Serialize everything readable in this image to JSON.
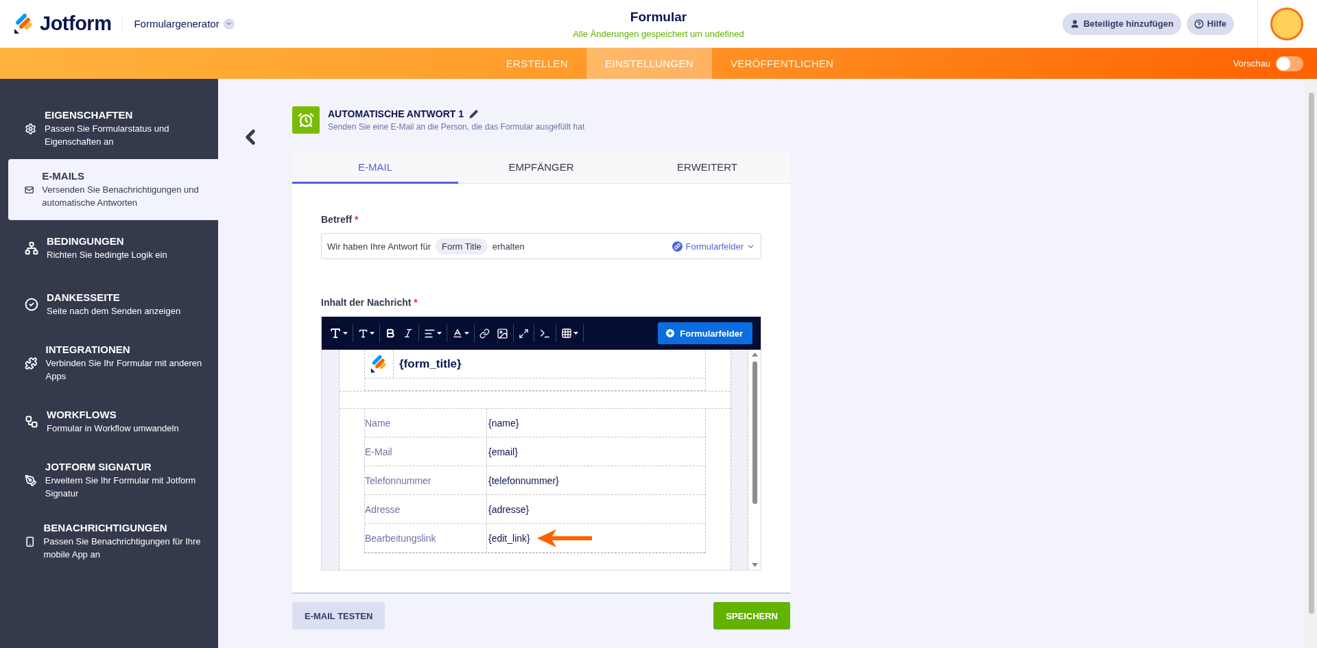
{
  "header": {
    "logo": "Jotform",
    "builder_menu": "Formulargenerator",
    "title": "Formular",
    "status": "Alle Änderungen gespeichert um undefined",
    "buttons": [
      {
        "label": "Beteiligte hinzufügen",
        "kind": "user"
      },
      {
        "label": "Hilfe",
        "kind": "help"
      }
    ]
  },
  "nav_tabs": [
    {
      "label": "ERSTELLEN",
      "selected": false
    },
    {
      "label": "EINSTELLUNGEN",
      "selected": true
    },
    {
      "label": "VERÖFFENTLICHEN",
      "selected": false
    }
  ],
  "preview": {
    "label": "Vorschau",
    "on": false
  },
  "sidebar": {
    "items": [
      {
        "kind": "gear",
        "title": "EIGENSCHAFTEN",
        "description": "Passen Sie Formularstatus und Eigenschaften an",
        "selected": false
      },
      {
        "kind": "mail",
        "title": "E-MAILS",
        "description": "Versenden Sie Benachrichtigungen und automatische Antworten",
        "selected": true
      },
      {
        "kind": "logic",
        "title": "BEDINGUNGEN",
        "description": "Richten Sie bedingte Logik ein",
        "selected": false
      },
      {
        "kind": "check",
        "title": "DANKESSEITE",
        "description": "Seite nach dem Senden anzeigen",
        "selected": false
      },
      {
        "kind": "puzzle",
        "title": "INTEGRATIONEN",
        "description": "Verbinden Sie Ihr Formular mit anderen Apps",
        "selected": false
      },
      {
        "kind": "workflow",
        "title": "WORKFLOWS",
        "description": "Formular in Workflow umwandeln",
        "selected": false
      },
      {
        "kind": "pen",
        "title": "JOTFORM SIGNATUR",
        "description": "Erweitern Sie Ihr Formular mit Jotform Signatur",
        "selected": false
      },
      {
        "kind": "phone",
        "title": "BENACHRICHTIGUNGEN",
        "description": "Passen Sie Benachrichtigungen für Ihre mobile App an",
        "selected": false
      }
    ]
  },
  "page": {
    "title": "AUTOMATISCHE ANTWORT 1",
    "subtitle": "Senden Sie eine E-Mail an die Person, die das Formular ausgefüllt hat"
  },
  "tabs": [
    {
      "label": "E-MAIL",
      "selected": true
    },
    {
      "label": "EMPFÄNGER",
      "selected": false
    },
    {
      "label": "ERWEITERT",
      "selected": false
    }
  ],
  "subject": {
    "label": "Betreff",
    "required_mark": "*",
    "parts": [
      {
        "kind": "text",
        "text": "Wir haben Ihre Antwort für"
      },
      {
        "kind": "tag",
        "text": "Form Title"
      },
      {
        "kind": "text",
        "text": "erhalten"
      }
    ],
    "fields_button": "Formularfelder"
  },
  "message": {
    "label": "Inhalt der Nachricht",
    "required_mark": "*",
    "fields_button": "Formularfelder",
    "form_title": "{form_title}",
    "rows": [
      {
        "label": "Name",
        "value": "{name}",
        "highlighted": false
      },
      {
        "label": "E-Mail",
        "value": "{email}",
        "highlighted": false
      },
      {
        "label": "Telefonnummer",
        "value": "{telefonnummer}",
        "highlighted": false
      },
      {
        "label": "Adresse",
        "value": "{adresse}",
        "highlighted": false
      },
      {
        "label": "Bearbeitungslink",
        "value": "{edit_link}",
        "highlighted": true
      }
    ]
  },
  "actions": {
    "test": "E-MAIL TESTEN",
    "save": "SPEICHERN"
  }
}
